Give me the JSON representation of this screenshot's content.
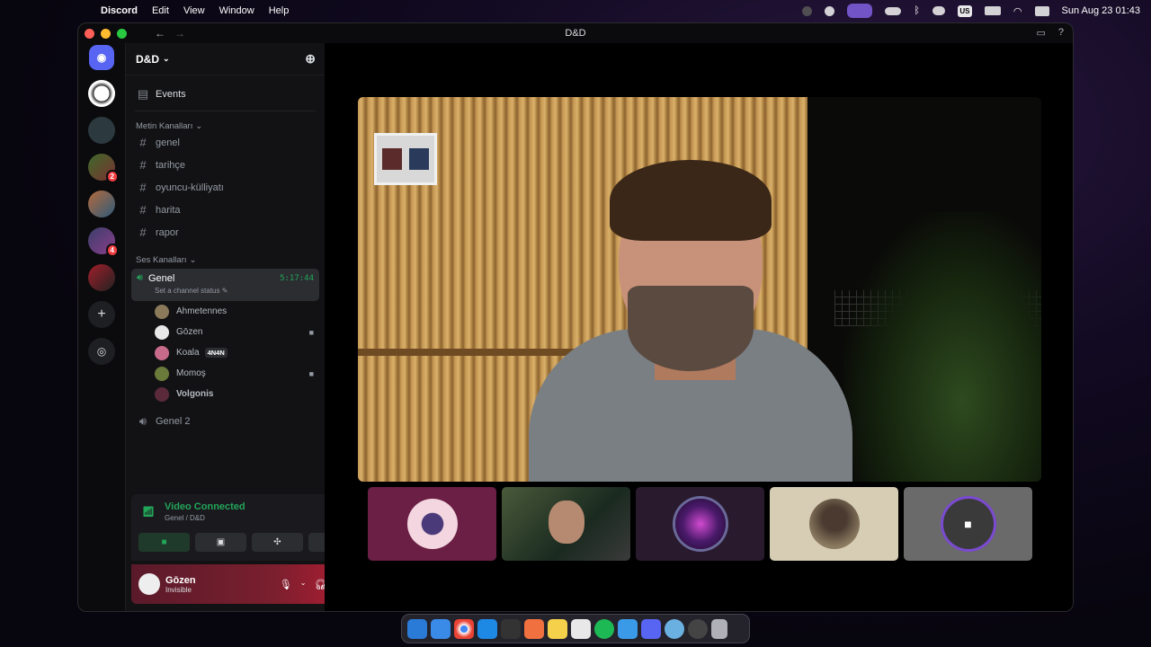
{
  "menubar": {
    "app": "Discord",
    "items": [
      "Edit",
      "View",
      "Window",
      "Help"
    ],
    "layout_badge": "US",
    "datetime": "Sun Aug 23  01:43"
  },
  "window": {
    "title": "D&D"
  },
  "servers": [
    {
      "name": "panda-server",
      "badge": ""
    },
    {
      "name": "server-2",
      "badge": ""
    },
    {
      "name": "server-3",
      "badge": "2"
    },
    {
      "name": "server-4",
      "badge": ""
    },
    {
      "name": "server-5",
      "badge": "4"
    },
    {
      "name": "server-6",
      "badge": ""
    }
  ],
  "guild": {
    "name": "D&D",
    "events_label": "Events"
  },
  "text_category": "Metin Kanalları",
  "text_channels": [
    "genel",
    "tarihçe",
    "oyuncu-külliyatı",
    "harita",
    "rapor"
  ],
  "voice_category": "Ses Kanalları",
  "voice_active": {
    "name": "Genel",
    "status": "Set a channel status",
    "timer": "5:17:44"
  },
  "voice_users": [
    {
      "name": "Ahmetennes",
      "camera": false,
      "tag": ""
    },
    {
      "name": "Gōzen",
      "camera": true,
      "tag": ""
    },
    {
      "name": "Koala",
      "camera": false,
      "tag": "4N4N"
    },
    {
      "name": "Momoş",
      "camera": true,
      "tag": ""
    },
    {
      "name": "Volgonis",
      "camera": false,
      "tag": ""
    }
  ],
  "voice_other": "Genel 2",
  "connection": {
    "title": "Video Connected",
    "subtitle": "Genel / D&D"
  },
  "user": {
    "name": "Gōzen",
    "status": "Invisible"
  },
  "colors": {
    "connected_green": "#23a559",
    "badge_red": "#f23f43",
    "accent_purple": "#7b5cd6"
  }
}
